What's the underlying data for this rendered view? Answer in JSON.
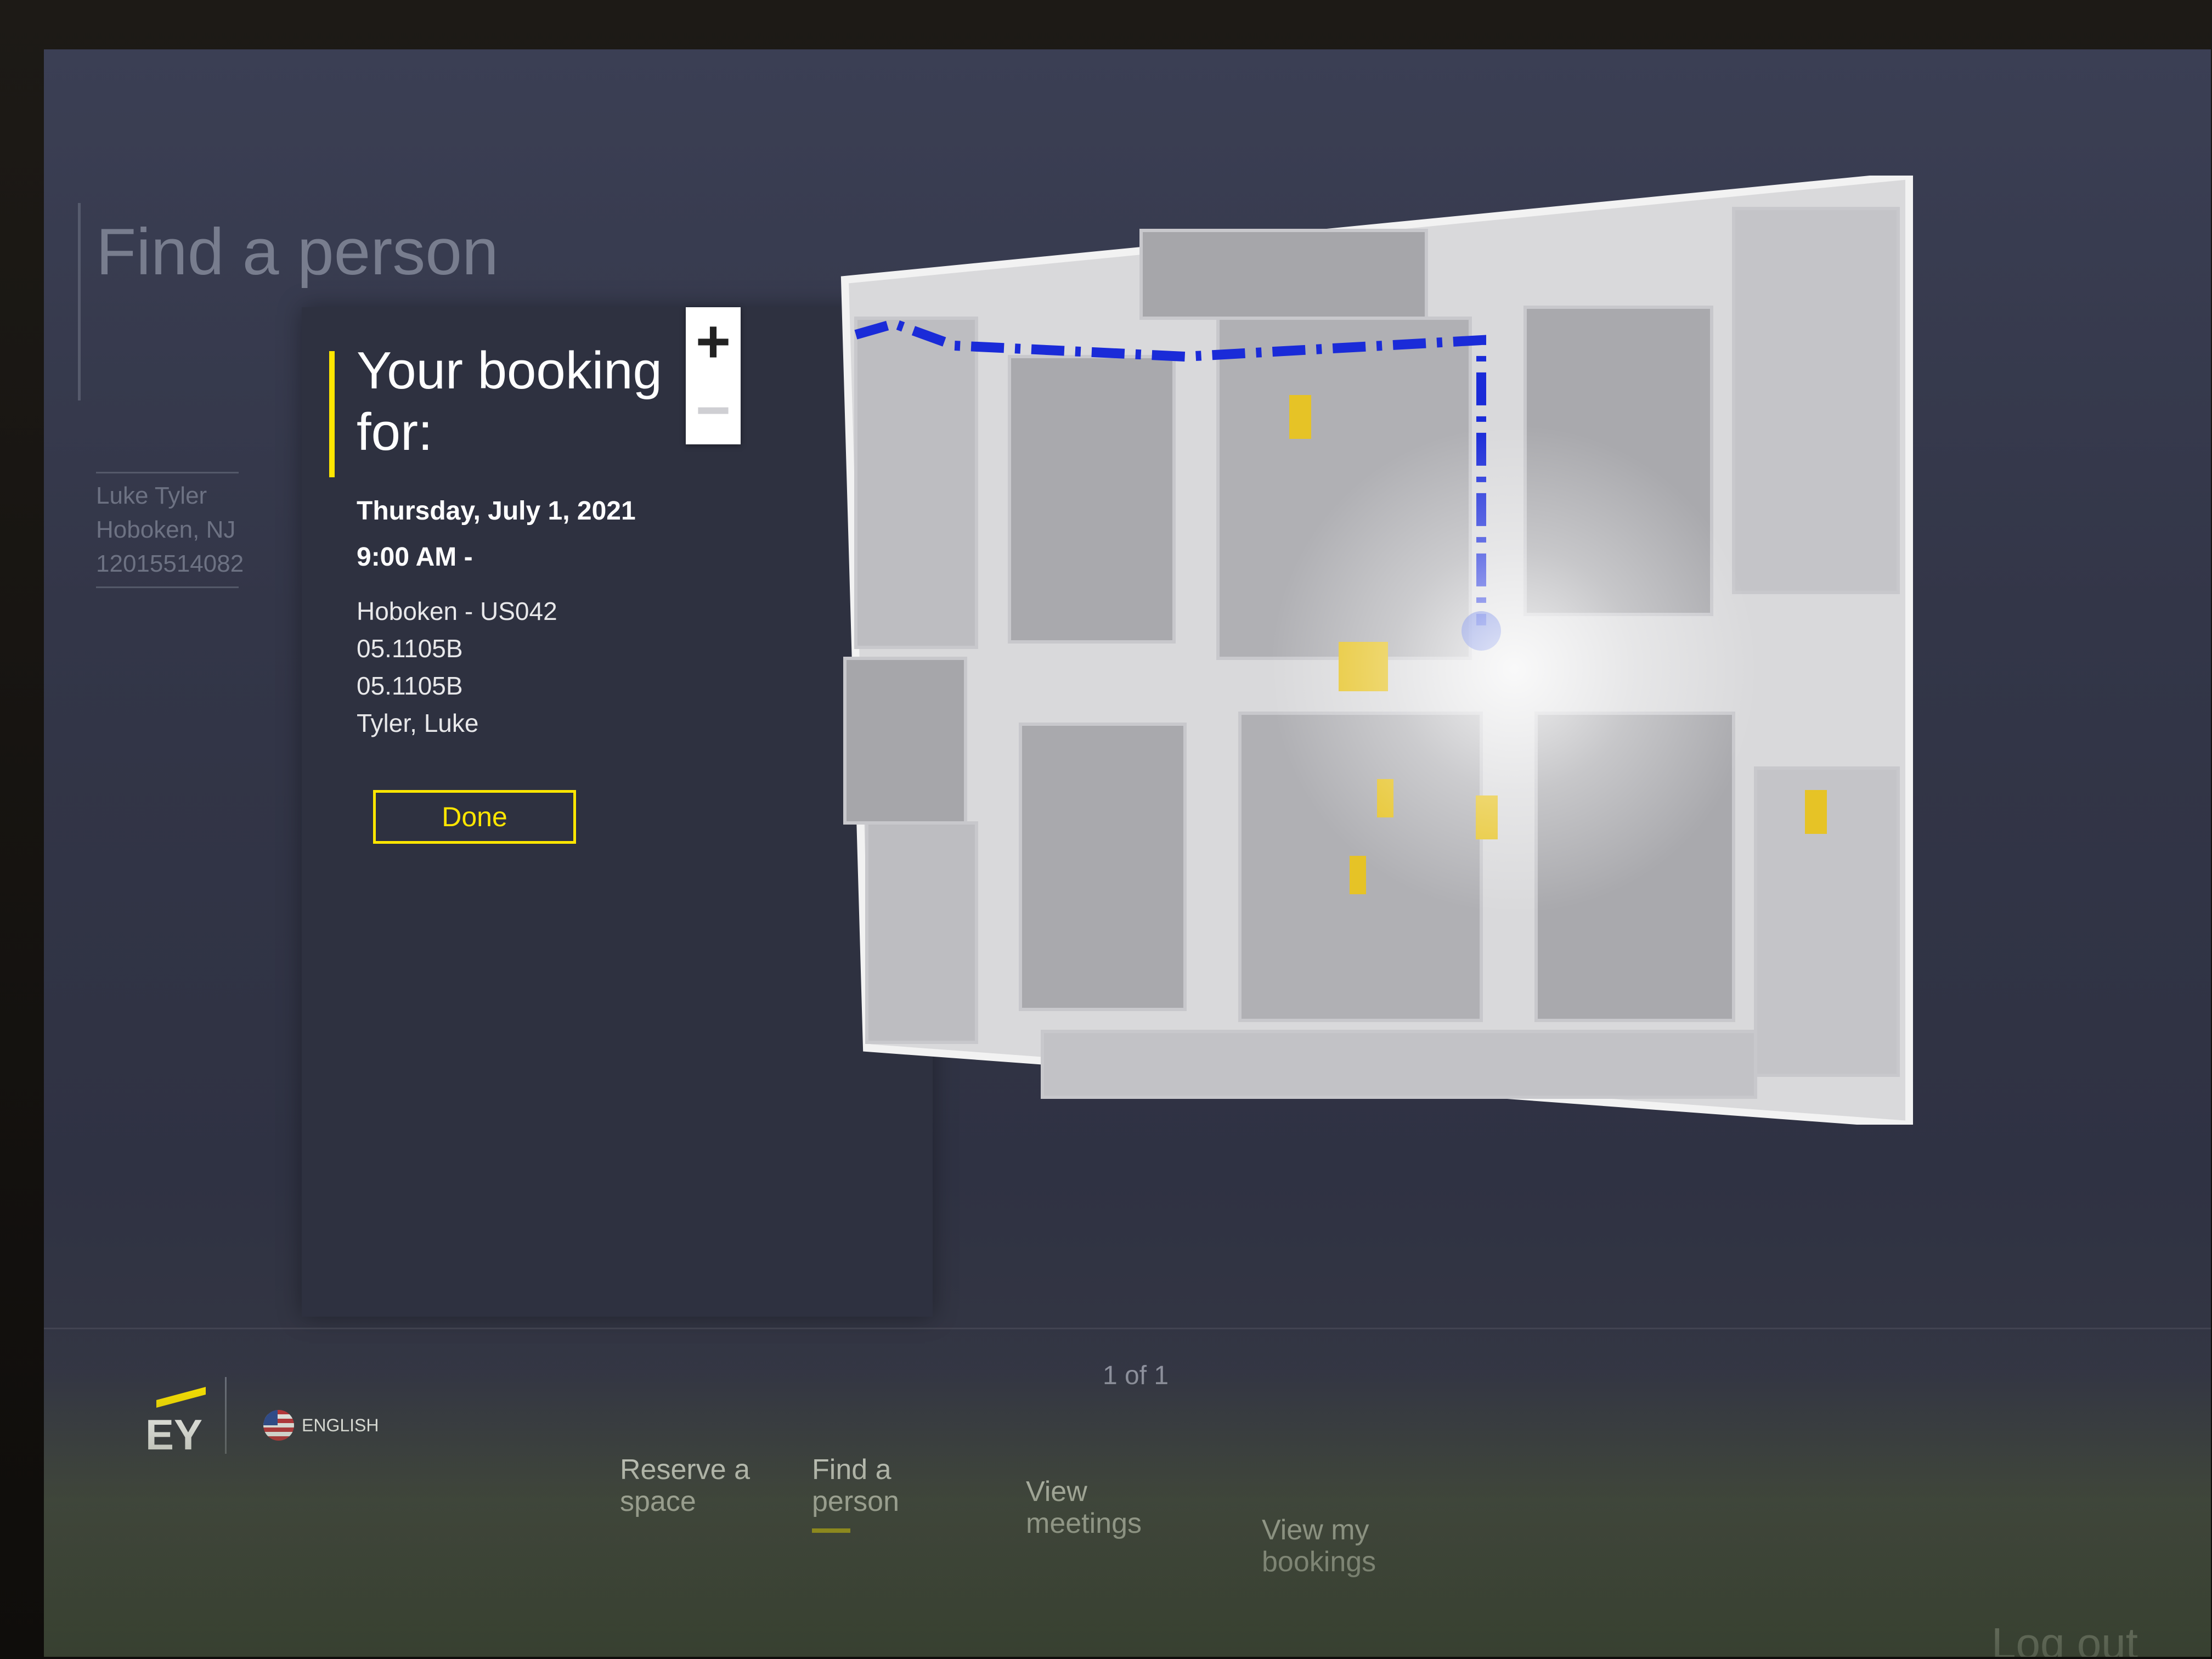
{
  "page": {
    "title": "Find a person"
  },
  "profile": {
    "name": "Luke Tyler",
    "location": "Hoboken, NJ",
    "phone": "12015514082"
  },
  "booking": {
    "heading": "Your booking for:",
    "date": "Thursday, July 1, 2021",
    "time": "9:00 AM -",
    "building": "Hoboken - US042",
    "space_line1": "05.1105B",
    "space_line2": "05.1105B",
    "person": "Tyler, Luke",
    "done_label": "Done"
  },
  "zoom": {
    "plus": "+",
    "minus": "−"
  },
  "pager": {
    "text": "1 of 1"
  },
  "footer": {
    "logo": "EY",
    "language": "ENGLISH",
    "nav": [
      {
        "label": "Reserve a space"
      },
      {
        "label": "Find a person",
        "active": true
      },
      {
        "label": "View meetings"
      },
      {
        "label": "View my bookings"
      }
    ],
    "logout": "Log out"
  },
  "colors": {
    "accent": "#ffe600",
    "route": "#1a2bd8",
    "panel": "#2e3140"
  },
  "icons": [
    "zoom-in-icon",
    "zoom-out-icon",
    "us-flag-icon",
    "stairs-icon",
    "restroom-icon",
    "elevator-icon",
    "location-pin-icon"
  ]
}
